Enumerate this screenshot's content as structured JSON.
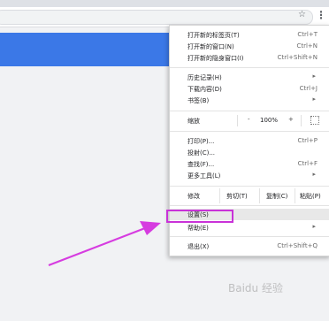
{
  "browser": {
    "star_icon": "☆",
    "menu_icon": "⋮"
  },
  "menu": {
    "new_tab": {
      "label": "打开新的标签页(T)",
      "shortcut": "Ctrl+T"
    },
    "new_window": {
      "label": "打开新的窗口(N)",
      "shortcut": "Ctrl+N"
    },
    "incognito": {
      "label": "打开新的隐身窗口(I)",
      "shortcut": "Ctrl+Shift+N"
    },
    "history": {
      "label": "历史记录(H)"
    },
    "downloads": {
      "label": "下载内容(D)",
      "shortcut": "Ctrl+J"
    },
    "bookmarks": {
      "label": "书签(B)"
    },
    "zoom": {
      "label": "缩放",
      "minus": "-",
      "value": "100%",
      "plus": "+"
    },
    "print": {
      "label": "打印(P)...",
      "shortcut": "Ctrl+P"
    },
    "cast": {
      "label": "投射(C)..."
    },
    "find": {
      "label": "查找(F)...",
      "shortcut": "Ctrl+F"
    },
    "more_tools": {
      "label": "更多工具(L)"
    },
    "edit": {
      "label": "修改",
      "cut": "剪切(T)",
      "copy": "复制(C)",
      "paste": "粘贴(P)"
    },
    "settings": {
      "label": "设置(S)"
    },
    "help": {
      "label": "帮助(E)"
    },
    "exit": {
      "label": "退出(X)",
      "shortcut": "Ctrl+Shift+Q"
    },
    "submenu_arrow": "▸"
  },
  "annotation": {
    "highlight_color": "#c932d8",
    "arrow_color": "#d63ce0"
  },
  "watermark": "Baidu 经验"
}
